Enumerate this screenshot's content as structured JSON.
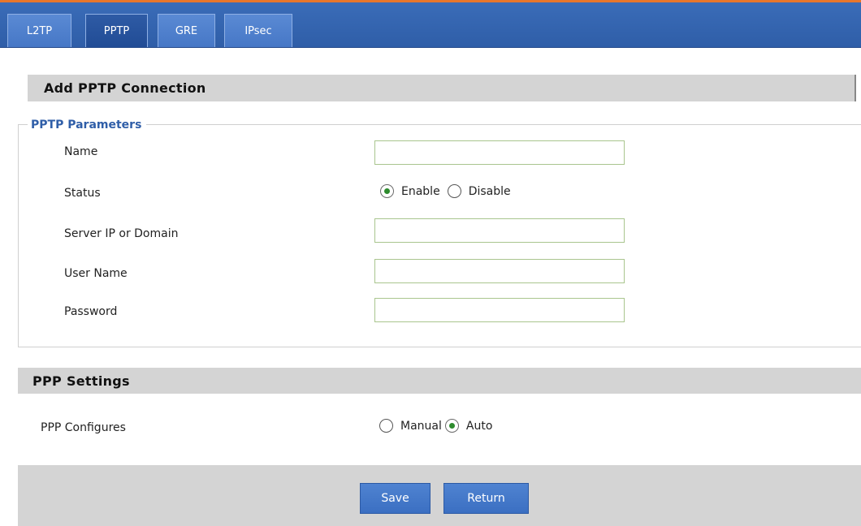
{
  "tabs": [
    {
      "label": "L2TP",
      "active": false
    },
    {
      "label": "PPTP",
      "active": true
    },
    {
      "label": "GRE",
      "active": false
    },
    {
      "label": "IPsec",
      "active": false
    }
  ],
  "header": {
    "title": "Add PPTP Connection"
  },
  "pptp": {
    "legend": "PPTP Parameters",
    "name_label": "Name",
    "name_value": "",
    "status_label": "Status",
    "status_enable": "Enable",
    "status_disable": "Disable",
    "status_selected": "Enable",
    "server_label": "Server IP or Domain",
    "server_value": "",
    "username_label": "User Name",
    "username_value": "",
    "password_label": "Password",
    "password_value": ""
  },
  "ppp": {
    "title": "PPP Settings",
    "configures_label": "PPP Configures",
    "manual_label": "Manual",
    "auto_label": "Auto",
    "selected": "Auto"
  },
  "footer": {
    "save_label": "Save",
    "return_label": "Return"
  },
  "colors": {
    "tabbar": "#2f5ea8",
    "accent": "#e8762c",
    "section": "#d4d4d4",
    "legend": "#2f5ea8",
    "button": "#3b6fc2"
  }
}
